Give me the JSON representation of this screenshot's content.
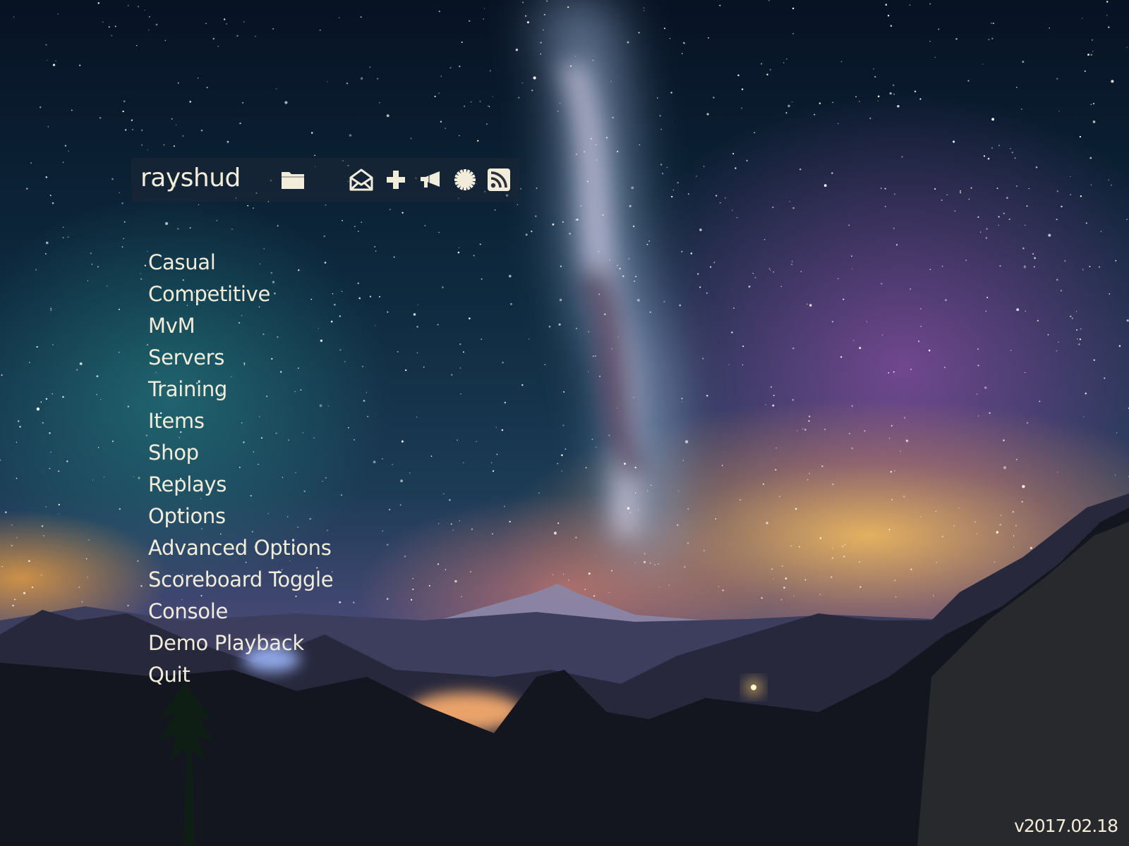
{
  "hud": {
    "title": "rayshud"
  },
  "toolbar": {
    "icons": [
      {
        "name": "folder-icon",
        "label": "backpack"
      },
      {
        "name": "envelope-icon",
        "label": "notifications"
      },
      {
        "name": "plus-icon",
        "label": "create server"
      },
      {
        "name": "megaphone-icon",
        "label": "report player"
      },
      {
        "name": "gear-icon",
        "label": "settings"
      },
      {
        "name": "rss-icon",
        "label": "news"
      }
    ]
  },
  "menu": {
    "items": [
      {
        "label": "Casual"
      },
      {
        "label": "Competitive"
      },
      {
        "label": "MvM"
      },
      {
        "label": "Servers"
      },
      {
        "label": "Training"
      },
      {
        "label": "Items"
      },
      {
        "label": "Shop"
      },
      {
        "label": "Replays"
      },
      {
        "label": "Options"
      },
      {
        "label": "Advanced Options"
      },
      {
        "label": "Scoreboard Toggle"
      },
      {
        "label": "Console"
      },
      {
        "label": "Demo Playback"
      },
      {
        "label": "Quit"
      }
    ]
  },
  "footer": {
    "version": "v2017.02.18"
  },
  "colors": {
    "text": "#f2ecda",
    "toolbar_bg": "#1e2837"
  }
}
